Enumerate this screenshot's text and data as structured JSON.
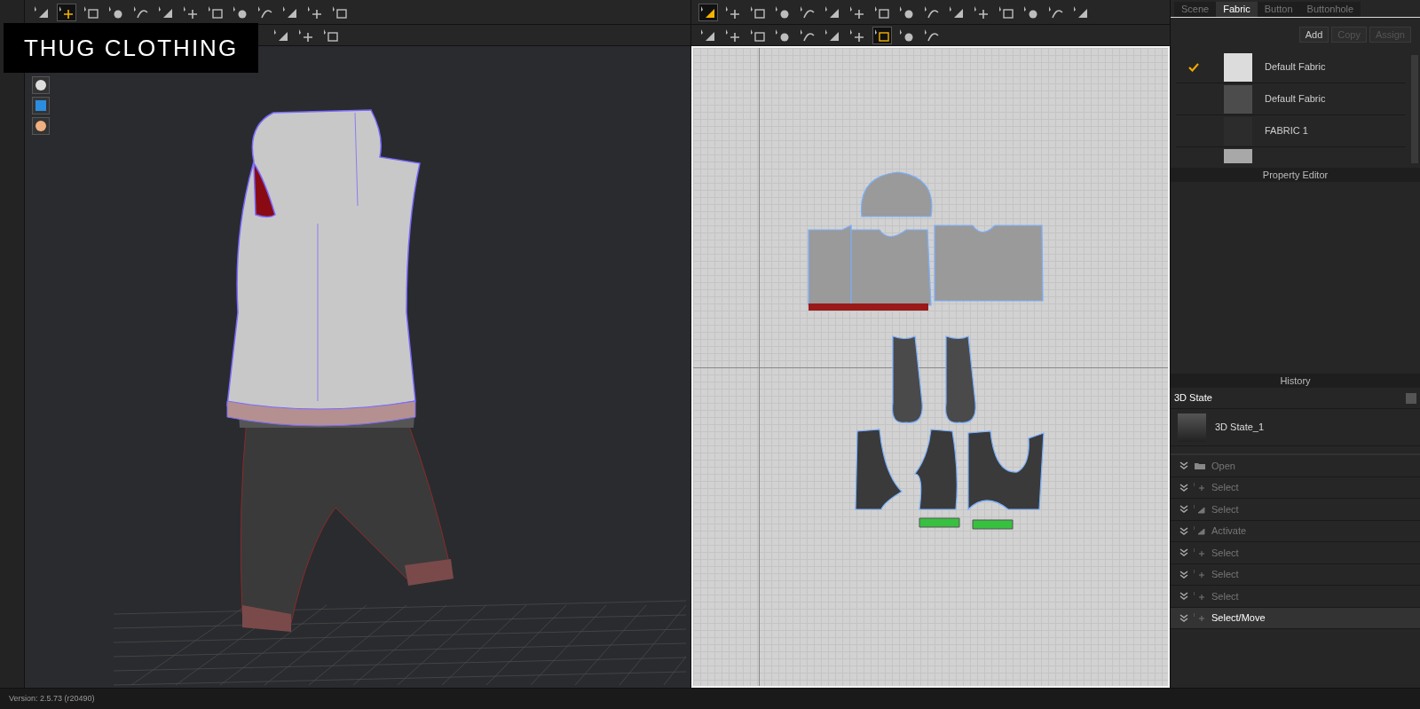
{
  "banner": {
    "title": "THUG CLOTHING"
  },
  "toolbar_3d": [
    [
      {
        "selected": false
      },
      {
        "selected": true
      },
      {
        "selected": false
      },
      {
        "selected": false
      },
      {
        "selected": false
      },
      {
        "selected": false
      },
      {
        "selected": false
      },
      {
        "selected": false
      },
      {
        "selected": false
      },
      {
        "selected": false
      },
      {
        "selected": false
      },
      {
        "selected": false
      },
      {
        "selected": false
      }
    ],
    [
      {
        "selected": false
      },
      {
        "selected": false
      },
      {
        "selected": false
      }
    ]
  ],
  "toolbar_2d": [
    [
      {
        "selected": true
      },
      {
        "selected": false
      },
      {
        "selected": false
      },
      {
        "selected": false
      },
      {
        "selected": false
      },
      {
        "selected": false
      },
      {
        "selected": false
      },
      {
        "selected": false
      },
      {
        "selected": false
      },
      {
        "selected": false
      },
      {
        "selected": false
      },
      {
        "selected": false
      },
      {
        "selected": false
      },
      {
        "selected": false
      },
      {
        "selected": false
      },
      {
        "selected": false
      }
    ],
    [
      {
        "selected": false
      },
      {
        "selected": false
      },
      {
        "selected": false
      },
      {
        "selected": false
      },
      {
        "selected": false
      },
      {
        "selected": false
      },
      {
        "selected": false
      },
      {
        "selected": true
      },
      {
        "selected": false
      },
      {
        "selected": false
      }
    ]
  ],
  "object_browser": {
    "tabs": [
      {
        "label": "Scene",
        "selected": false
      },
      {
        "label": "Fabric",
        "selected": true
      },
      {
        "label": "Button",
        "selected": false
      },
      {
        "label": "Buttonhole",
        "selected": false
      }
    ],
    "buttons": [
      {
        "label": "Add",
        "disabled": false
      },
      {
        "label": "Copy",
        "disabled": true
      },
      {
        "label": "Assign",
        "disabled": true
      }
    ],
    "fabrics": [
      {
        "name": "Default Fabric",
        "checked": true,
        "color": "#dcdcdc"
      },
      {
        "name": "Default Fabric",
        "checked": false,
        "color": "#4c4c4c"
      },
      {
        "name": "FABRIC 1",
        "checked": false,
        "color": "#2c2c2c"
      },
      {
        "checked": false,
        "color": "#a8a8a8"
      }
    ]
  },
  "property_editor": {
    "title": "Property Editor"
  },
  "history": {
    "title": "History",
    "section": "3D State",
    "state": "3D State_1",
    "items": [
      {
        "label": "Open",
        "kind": "folder",
        "selected": false
      },
      {
        "label": "Select",
        "kind": "move",
        "selected": false
      },
      {
        "label": "Select",
        "kind": "triangle",
        "selected": false
      },
      {
        "label": "Activate",
        "kind": "triangle",
        "selected": false
      },
      {
        "label": "Select",
        "kind": "move",
        "selected": false
      },
      {
        "label": "Select",
        "kind": "move",
        "selected": false
      },
      {
        "label": "Select",
        "kind": "move",
        "selected": false
      },
      {
        "label": "Select/Move",
        "kind": "move",
        "selected": true
      }
    ]
  },
  "status_bar": {
    "version": "Version: 2.5.73 (r20490)"
  }
}
